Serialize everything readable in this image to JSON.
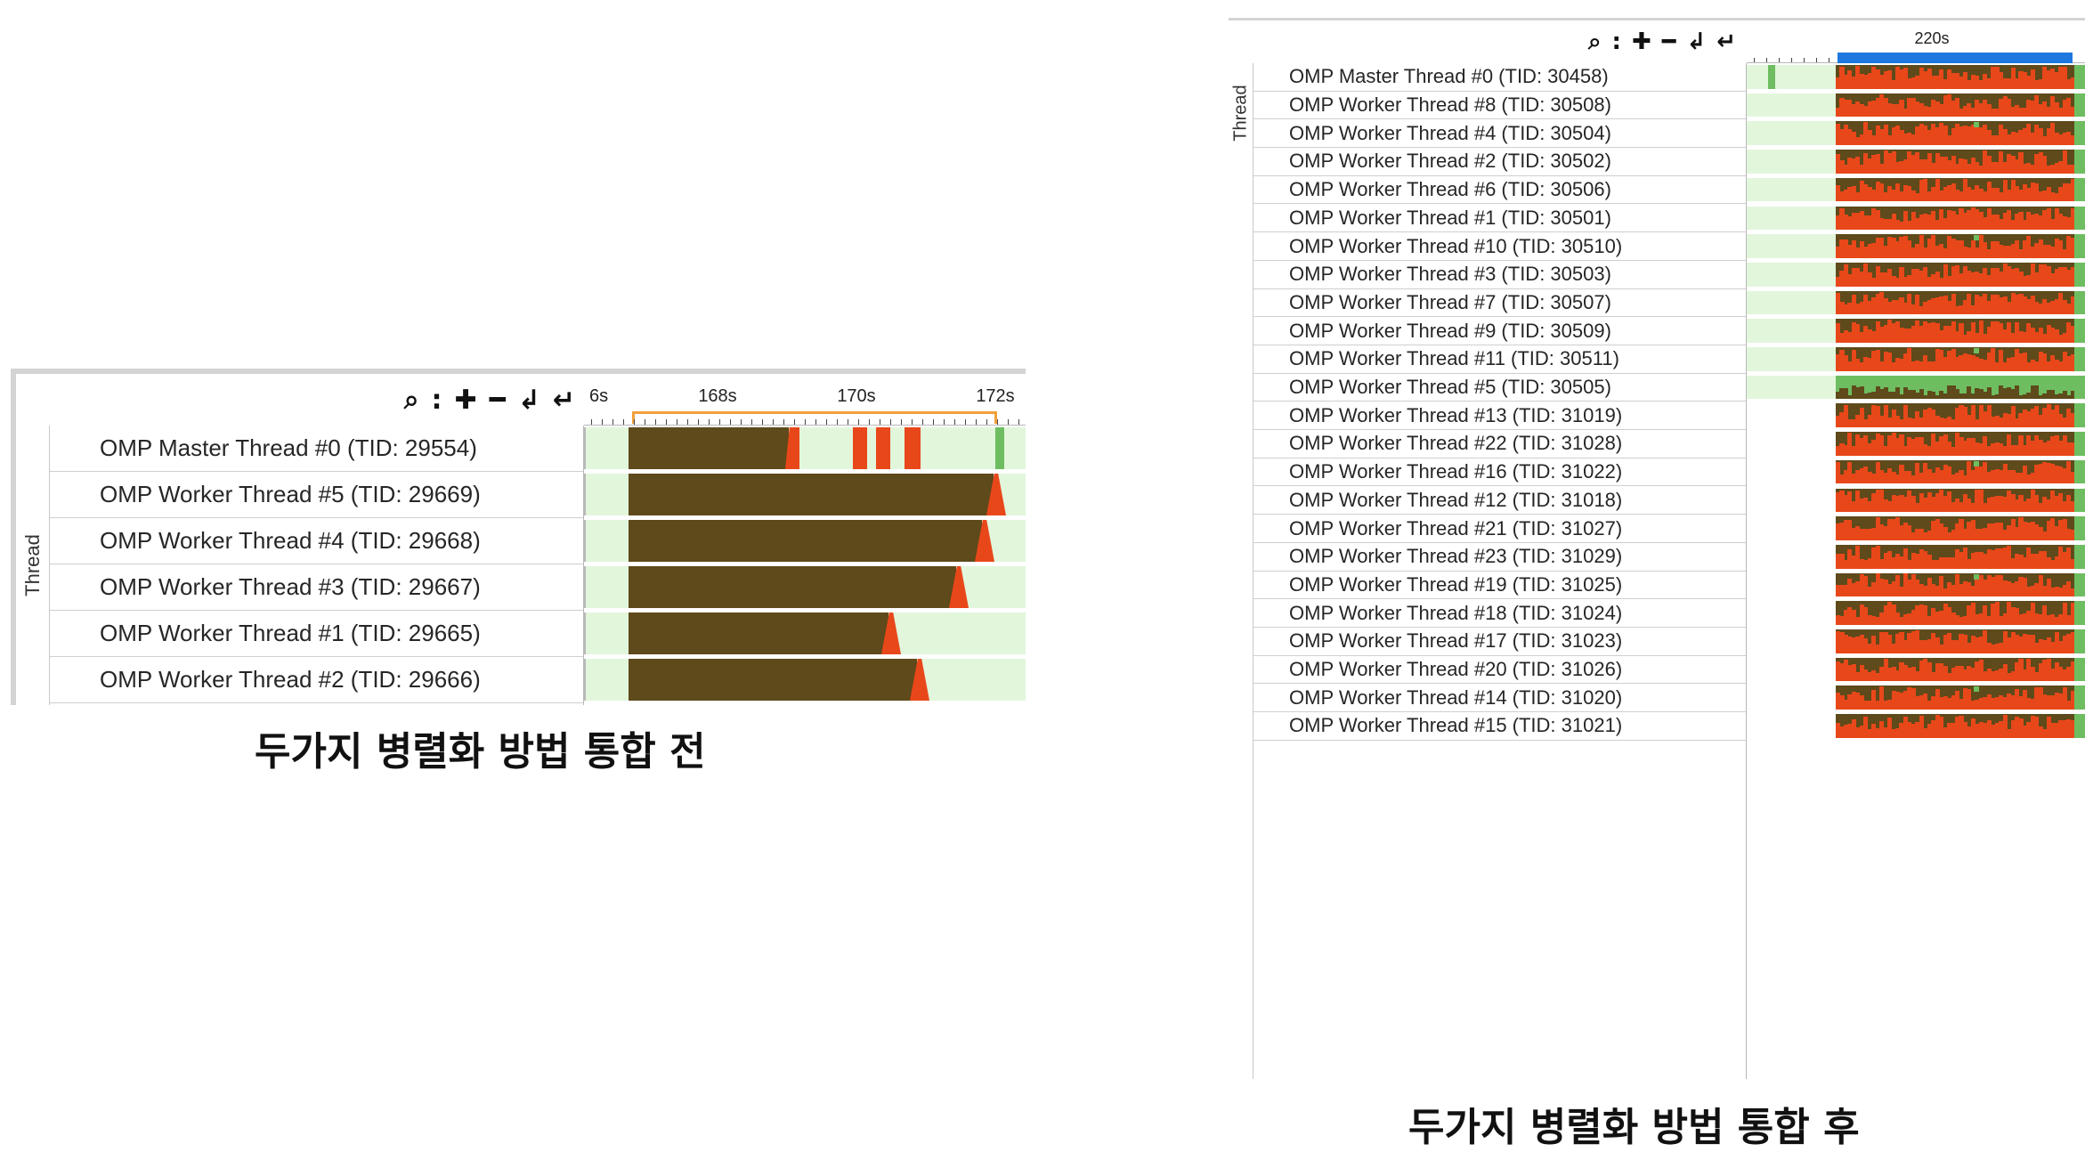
{
  "colors": {
    "idle": "#e2f6dc",
    "wait": "#6ebd60",
    "busy": "#5e4a1a",
    "spin": "#e8471a",
    "ruler_sel_before": "#f2a03a",
    "ruler_sel_after": "#1e78e0"
  },
  "toolbar": {
    "icons": [
      "search-icon",
      "colon-separator",
      "zoom-in-icon",
      "zoom-out-icon",
      "undo-zoom-icon",
      "reset-zoom-icon"
    ]
  },
  "before": {
    "axis_label": "Thread",
    "ticks": [
      "6s",
      "168s",
      "170s",
      "172s"
    ],
    "caption": "두가지 병렬화 방법 통합 전",
    "threads": [
      "OMP Master Thread #0 (TID: 29554)",
      "OMP Worker Thread #5 (TID: 29669)",
      "OMP Worker Thread #4 (TID: 29668)",
      "OMP Worker Thread #3 (TID: 29667)",
      "OMP Worker Thread #1 (TID: 29665)",
      "OMP Worker Thread #2 (TID: 29666)"
    ]
  },
  "after": {
    "axis_label": "Thread",
    "ticks": [
      "220s"
    ],
    "caption": "두가지 병렬화 방법 통합 후",
    "threads": [
      "OMP Master Thread #0 (TID: 30458)",
      "OMP Worker Thread #8 (TID: 30508)",
      "OMP Worker Thread #4 (TID: 30504)",
      "OMP Worker Thread #2 (TID: 30502)",
      "OMP Worker Thread #6 (TID: 30506)",
      "OMP Worker Thread #1 (TID: 30501)",
      "OMP Worker Thread #10 (TID: 30510)",
      "OMP Worker Thread #3 (TID: 30503)",
      "OMP Worker Thread #7 (TID: 30507)",
      "OMP Worker Thread #9 (TID: 30509)",
      "OMP Worker Thread #11 (TID: 30511)",
      "OMP Worker Thread #5 (TID: 30505)",
      "OMP Worker Thread #13 (TID: 31019)",
      "OMP Worker Thread #22 (TID: 31028)",
      "OMP Worker Thread #16 (TID: 31022)",
      "OMP Worker Thread #12 (TID: 31018)",
      "OMP Worker Thread #21 (TID: 31027)",
      "OMP Worker Thread #23 (TID: 31029)",
      "OMP Worker Thread #19 (TID: 31025)",
      "OMP Worker Thread #18 (TID: 31024)",
      "OMP Worker Thread #17 (TID: 31023)",
      "OMP Worker Thread #20 (TID: 31026)",
      "OMP Worker Thread #14 (TID: 31020)",
      "OMP Worker Thread #15 (TID: 31021)"
    ]
  }
}
